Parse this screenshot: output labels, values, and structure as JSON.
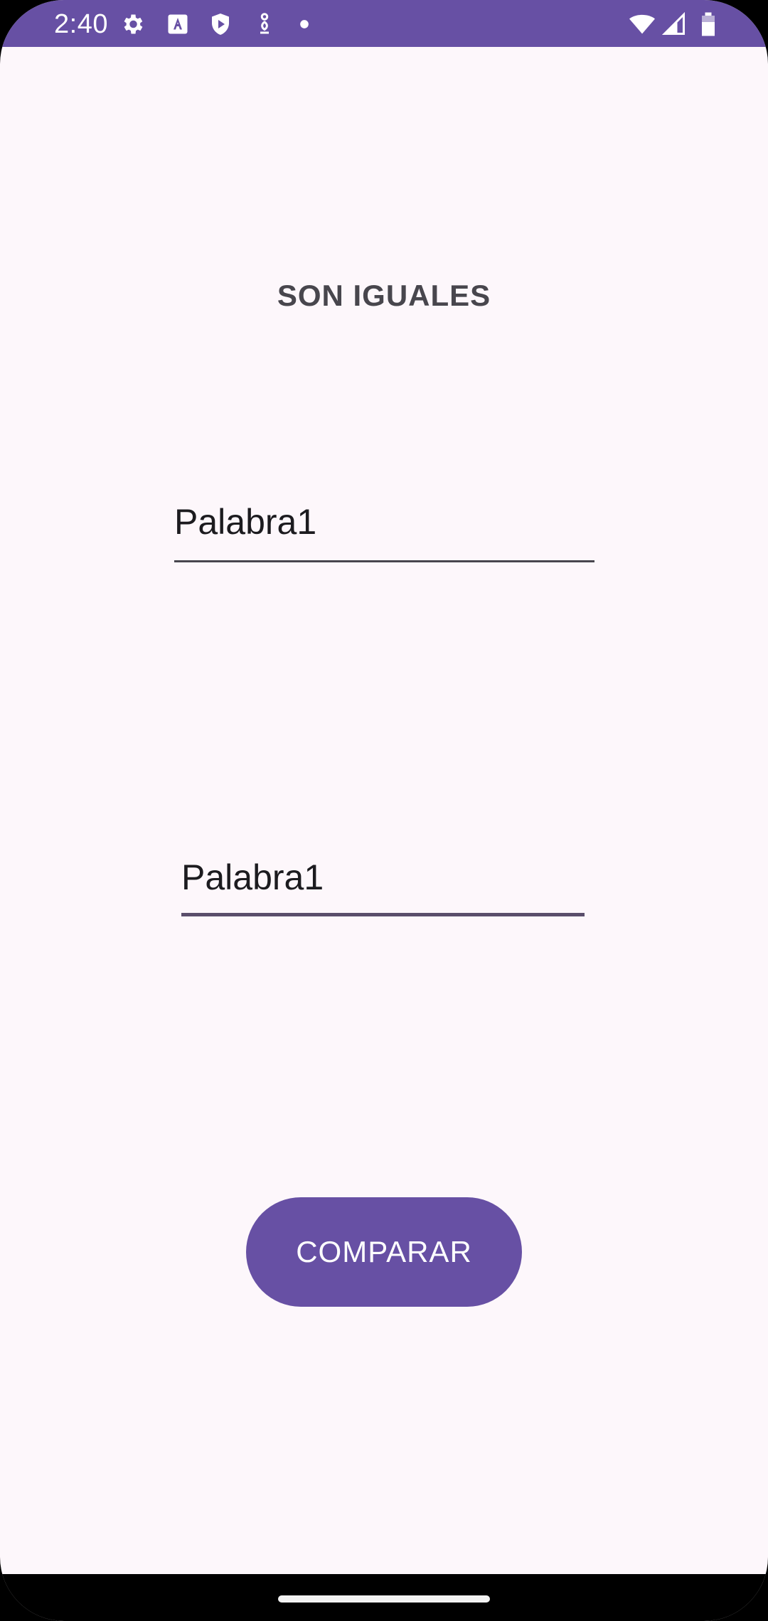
{
  "status_bar": {
    "time": "2:40",
    "icons_left": [
      "gear-icon",
      "font-a-icon",
      "shield-play-icon",
      "accessibility-icon",
      "dot-icon"
    ],
    "icons_right": [
      "wifi-icon",
      "cell-signal-icon",
      "battery-icon"
    ],
    "color": "#6750a4"
  },
  "main": {
    "result_text": "SON IGUALES",
    "word1_value": "Palabra1",
    "word2_value": "Palabra1",
    "compare_label": "COMPARAR"
  },
  "colors": {
    "background": "#fdf7fb",
    "accent": "#6750a4",
    "text": "#1c1b1f"
  }
}
